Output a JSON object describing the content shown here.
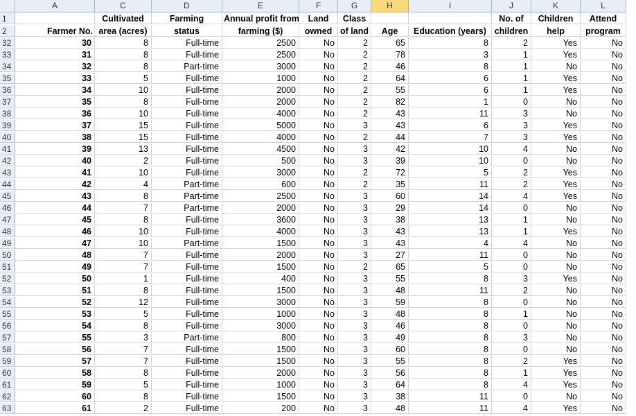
{
  "column_letters": [
    "",
    "A",
    "C",
    "D",
    "E",
    "F",
    "G",
    "H",
    "I",
    "J",
    "K",
    "L"
  ],
  "header_row1": {
    "row_number": "1",
    "cells": [
      "",
      "Cultivated",
      "Farming",
      "Annual profit from",
      "Land",
      "Class",
      "",
      "",
      "No. of",
      "Children",
      "Attend"
    ]
  },
  "header_row2": {
    "row_number": "2",
    "cells": [
      "Farmer No.",
      "area (acres)",
      "status",
      "farming ($)",
      "owned",
      "of land",
      "Age",
      "Education (years)",
      "children",
      "help",
      "program"
    ]
  },
  "rows": [
    {
      "rn": "32",
      "v": [
        "30",
        "8",
        "Full-time",
        "2500",
        "No",
        "2",
        "65",
        "8",
        "2",
        "Yes",
        "No"
      ]
    },
    {
      "rn": "33",
      "v": [
        "31",
        "8",
        "Full-time",
        "2500",
        "No",
        "2",
        "78",
        "3",
        "1",
        "Yes",
        "No"
      ]
    },
    {
      "rn": "34",
      "v": [
        "32",
        "8",
        "Part-time",
        "3000",
        "No",
        "2",
        "46",
        "8",
        "1",
        "No",
        "No"
      ]
    },
    {
      "rn": "35",
      "v": [
        "33",
        "5",
        "Full-time",
        "1000",
        "No",
        "2",
        "64",
        "6",
        "1",
        "Yes",
        "No"
      ]
    },
    {
      "rn": "36",
      "v": [
        "34",
        "10",
        "Full-time",
        "2000",
        "No",
        "2",
        "55",
        "6",
        "1",
        "Yes",
        "No"
      ]
    },
    {
      "rn": "37",
      "v": [
        "35",
        "8",
        "Full-time",
        "2000",
        "No",
        "2",
        "82",
        "1",
        "0",
        "No",
        "No"
      ]
    },
    {
      "rn": "38",
      "v": [
        "36",
        "10",
        "Full-time",
        "4000",
        "No",
        "2",
        "43",
        "11",
        "3",
        "No",
        "No"
      ]
    },
    {
      "rn": "39",
      "v": [
        "37",
        "15",
        "Full-time",
        "5000",
        "No",
        "3",
        "43",
        "6",
        "3",
        "Yes",
        "No"
      ]
    },
    {
      "rn": "40",
      "v": [
        "38",
        "15",
        "Full-time",
        "4000",
        "No",
        "2",
        "44",
        "7",
        "3",
        "Yes",
        "No"
      ]
    },
    {
      "rn": "41",
      "v": [
        "39",
        "13",
        "Full-time",
        "4500",
        "No",
        "3",
        "42",
        "10",
        "4",
        "No",
        "No"
      ]
    },
    {
      "rn": "42",
      "v": [
        "40",
        "2",
        "Full-time",
        "500",
        "No",
        "3",
        "39",
        "10",
        "0",
        "No",
        "No"
      ]
    },
    {
      "rn": "43",
      "v": [
        "41",
        "10",
        "Full-time",
        "3000",
        "No",
        "2",
        "72",
        "5",
        "2",
        "Yes",
        "No"
      ]
    },
    {
      "rn": "44",
      "v": [
        "42",
        "4",
        "Part-time",
        "600",
        "No",
        "2",
        "35",
        "11",
        "2",
        "Yes",
        "No"
      ]
    },
    {
      "rn": "45",
      "v": [
        "43",
        "8",
        "Part-time",
        "2500",
        "No",
        "3",
        "60",
        "14",
        "4",
        "Yes",
        "No"
      ]
    },
    {
      "rn": "46",
      "v": [
        "44",
        "7",
        "Part-time",
        "2000",
        "No",
        "3",
        "29",
        "14",
        "0",
        "No",
        "No"
      ]
    },
    {
      "rn": "47",
      "v": [
        "45",
        "8",
        "Full-time",
        "3600",
        "No",
        "3",
        "38",
        "13",
        "1",
        "No",
        "No"
      ]
    },
    {
      "rn": "48",
      "v": [
        "46",
        "10",
        "Full-time",
        "4000",
        "No",
        "3",
        "43",
        "13",
        "1",
        "Yes",
        "No"
      ]
    },
    {
      "rn": "49",
      "v": [
        "47",
        "10",
        "Part-time",
        "1500",
        "No",
        "3",
        "43",
        "4",
        "4",
        "No",
        "No"
      ]
    },
    {
      "rn": "50",
      "v": [
        "48",
        "7",
        "Full-time",
        "2000",
        "No",
        "3",
        "27",
        "11",
        "0",
        "No",
        "No"
      ]
    },
    {
      "rn": "51",
      "v": [
        "49",
        "7",
        "Full-time",
        "1500",
        "No",
        "2",
        "65",
        "5",
        "0",
        "No",
        "No"
      ]
    },
    {
      "rn": "52",
      "v": [
        "50",
        "1",
        "Full-time",
        "400",
        "No",
        "3",
        "55",
        "8",
        "3",
        "Yes",
        "No"
      ]
    },
    {
      "rn": "53",
      "v": [
        "51",
        "8",
        "Full-time",
        "1500",
        "No",
        "3",
        "48",
        "11",
        "2",
        "No",
        "No"
      ]
    },
    {
      "rn": "54",
      "v": [
        "52",
        "12",
        "Full-time",
        "3000",
        "No",
        "3",
        "59",
        "8",
        "0",
        "No",
        "No"
      ]
    },
    {
      "rn": "55",
      "v": [
        "53",
        "5",
        "Full-time",
        "1000",
        "No",
        "3",
        "48",
        "8",
        "1",
        "No",
        "No"
      ]
    },
    {
      "rn": "56",
      "v": [
        "54",
        "8",
        "Full-time",
        "3000",
        "No",
        "3",
        "46",
        "8",
        "0",
        "No",
        "No"
      ]
    },
    {
      "rn": "57",
      "v": [
        "55",
        "3",
        "Part-time",
        "800",
        "No",
        "3",
        "49",
        "8",
        "3",
        "No",
        "No"
      ]
    },
    {
      "rn": "58",
      "v": [
        "56",
        "7",
        "Full-time",
        "1500",
        "No",
        "3",
        "60",
        "8",
        "0",
        "No",
        "No"
      ]
    },
    {
      "rn": "59",
      "v": [
        "57",
        "7",
        "Full-time",
        "1500",
        "No",
        "3",
        "55",
        "8",
        "2",
        "Yes",
        "No"
      ]
    },
    {
      "rn": "60",
      "v": [
        "58",
        "8",
        "Full-time",
        "2000",
        "No",
        "3",
        "56",
        "8",
        "1",
        "Yes",
        "No"
      ]
    },
    {
      "rn": "61",
      "v": [
        "59",
        "5",
        "Full-time",
        "1000",
        "No",
        "3",
        "64",
        "8",
        "4",
        "Yes",
        "No"
      ]
    },
    {
      "rn": "62",
      "v": [
        "60",
        "8",
        "Full-time",
        "1500",
        "No",
        "3",
        "38",
        "11",
        "0",
        "No",
        "No"
      ]
    },
    {
      "rn": "63",
      "v": [
        "61",
        "2",
        "Full-time",
        "200",
        "No",
        "3",
        "48",
        "11",
        "4",
        "Yes",
        "No"
      ]
    }
  ],
  "selected_column": "H",
  "colors": {
    "header_bg": "#e9eef6",
    "selected_header": "#f8d77d",
    "gridline": "#d4d4d4"
  }
}
